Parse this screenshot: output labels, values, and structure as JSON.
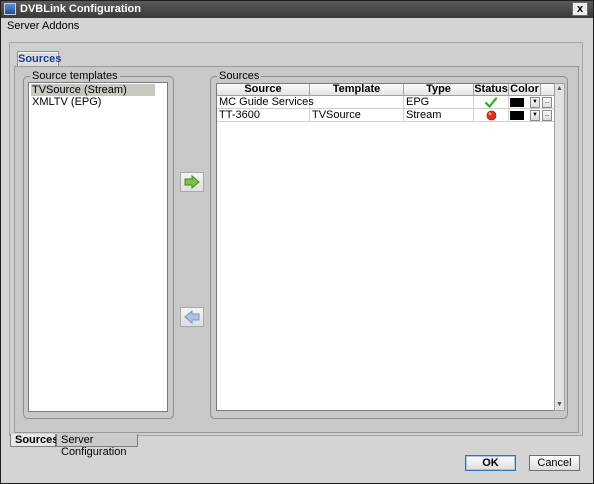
{
  "window": {
    "title": "DVBLink Configuration",
    "close_glyph": "x"
  },
  "menu": {
    "items": [
      "Server",
      "Addons"
    ]
  },
  "inner_tab": {
    "label": "Sources"
  },
  "templates": {
    "legend": "Source templates",
    "items": [
      "TVSource (Stream)",
      "XMLTV (EPG)"
    ],
    "selected_index": 0
  },
  "sources": {
    "legend": "Sources",
    "columns": [
      "Source",
      "Template",
      "Type",
      "Status",
      "Color"
    ],
    "rows": [
      {
        "source": "MC Guide Services",
        "template": "",
        "type": "EPG",
        "status": "ok",
        "status_icon": "check-icon",
        "color": "#000000"
      },
      {
        "source": "TT-3600",
        "template": "TVSource",
        "type": "Stream",
        "status": "error",
        "status_icon": "red-dot-icon",
        "color": "#000000"
      }
    ],
    "dropdown_glyph": "▼",
    "browse_glyph": "..."
  },
  "buttons": {
    "add_icon": "right-arrow-icon",
    "remove_icon": "left-arrow-icon",
    "ok": "OK",
    "cancel": "Cancel"
  },
  "bottom_tabs": [
    {
      "label": "Sources",
      "active": true
    },
    {
      "label": "Server Configuration",
      "active": false
    }
  ],
  "colors": {
    "accent": "#1a3f8c",
    "status_ok": "#3aa82a",
    "status_error": "#e0321e"
  }
}
